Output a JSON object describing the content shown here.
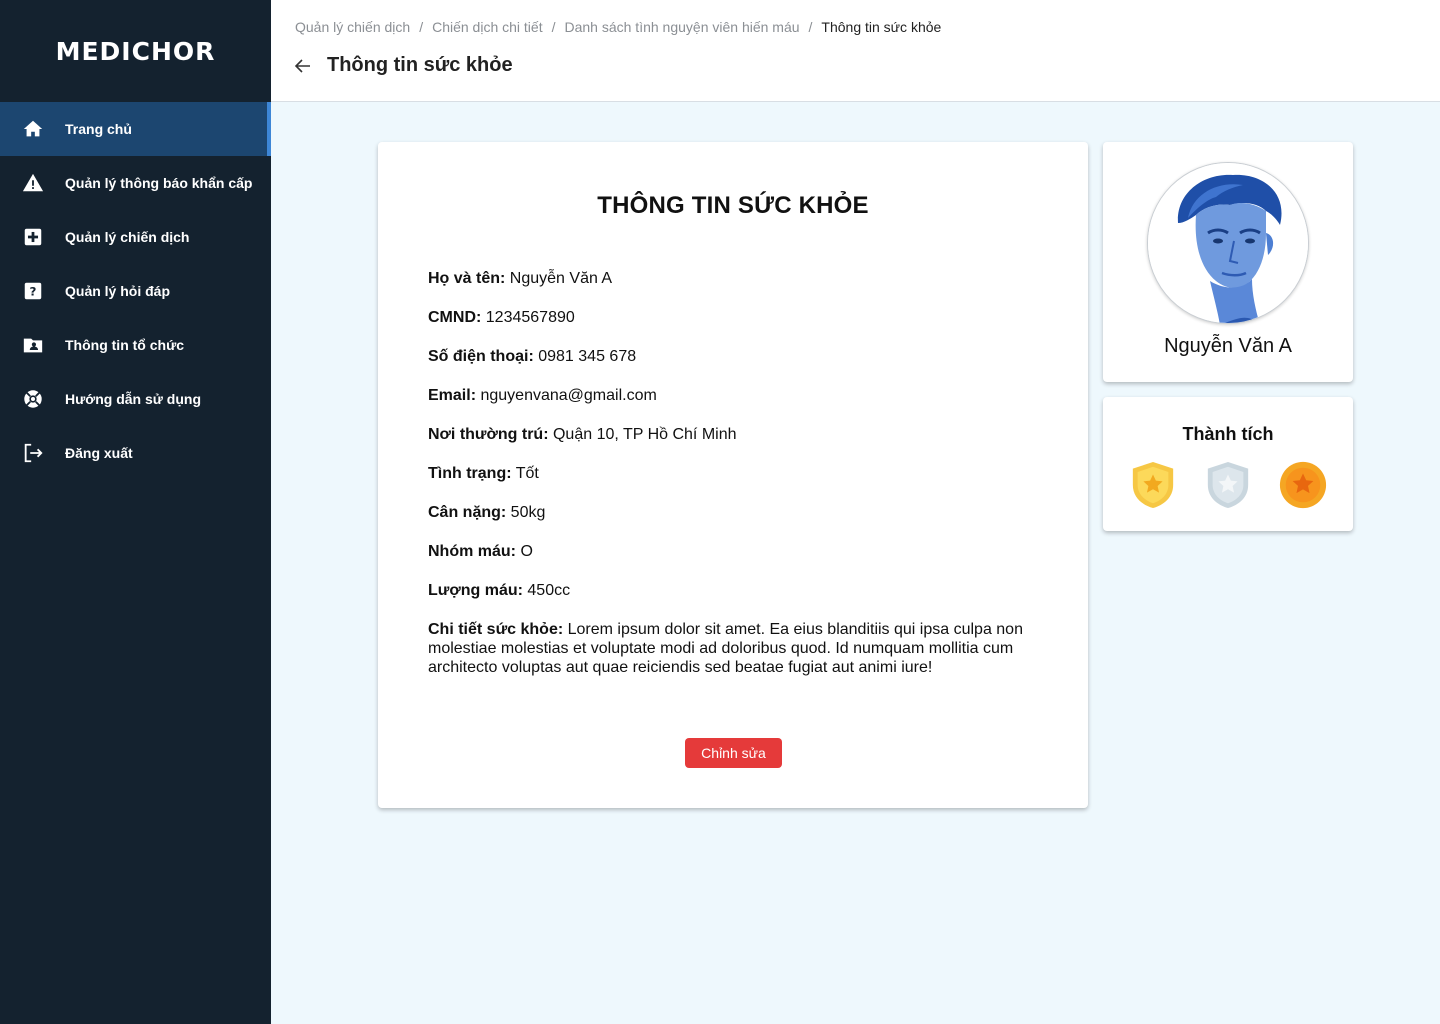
{
  "brand": {
    "logo": "MEDICHOR"
  },
  "sidebar": {
    "items": [
      {
        "label": "Trang chủ",
        "icon": "home-icon",
        "active": true
      },
      {
        "label": "Quản lý thông báo khẩn cấp",
        "icon": "warning-icon"
      },
      {
        "label": "Quản lý chiến dịch",
        "icon": "medical-plus-icon"
      },
      {
        "label": "Quản lý hỏi đáp",
        "icon": "question-icon"
      },
      {
        "label": "Thông tin tổ chức",
        "icon": "folder-user-icon"
      },
      {
        "label": "Hướng dẫn sử dụng",
        "icon": "lifebuoy-icon"
      },
      {
        "label": "Đăng xuất",
        "icon": "logout-icon"
      }
    ]
  },
  "breadcrumb": {
    "items": [
      "Quản lý chiến dịch",
      "Chiến dịch chi tiết",
      "Danh sách tình nguyện viên hiến máu",
      "Thông tin sức khỏe"
    ],
    "separator": "/"
  },
  "header": {
    "title": "Thông tin sức khỏe"
  },
  "health": {
    "heading": "THÔNG TIN SỨC KHỎE",
    "fields": [
      {
        "label": "Họ và tên:",
        "value": "Nguyễn Văn A"
      },
      {
        "label": "CMND:",
        "value": "1234567890"
      },
      {
        "label": "Số điện thoại:",
        "value": "0981 345 678"
      },
      {
        "label": "Email:",
        "value": "nguyenvana@gmail.com"
      },
      {
        "label": "Nơi thường trú:",
        "value": "Quận 10, TP Hồ Chí Minh"
      },
      {
        "label": "Tình trạng:",
        "value": "Tốt"
      },
      {
        "label": "Cân nặng:",
        "value": "50kg"
      },
      {
        "label": "Nhóm máu:",
        "value": "O"
      },
      {
        "label": "Lượng máu:",
        "value": "450cc"
      },
      {
        "label": "Chi tiết sức khỏe:",
        "value": "Lorem ipsum dolor sit amet. Ea eius blanditiis qui ipsa culpa non molestiae molestias et voluptate modi ad doloribus quod. Id numquam mollitia cum architecto voluptas aut quae reiciendis sed beatae fugiat aut animi iure!"
      }
    ],
    "edit_label": "Chỉnh sửa"
  },
  "profile": {
    "name": "Nguyễn Văn A"
  },
  "achievements": {
    "title": "Thành tích",
    "badges": [
      {
        "icon": "gold-shield-badge-icon",
        "color": "#f6c744"
      },
      {
        "icon": "silver-shield-badge-icon",
        "color": "#c9d6de"
      },
      {
        "icon": "bronze-medal-badge-icon",
        "color": "#f5a623"
      }
    ]
  },
  "colors": {
    "sidebar": "#14222f",
    "active": "#1c4670",
    "accent": "#e53a3a",
    "background": "#eef8fd"
  }
}
